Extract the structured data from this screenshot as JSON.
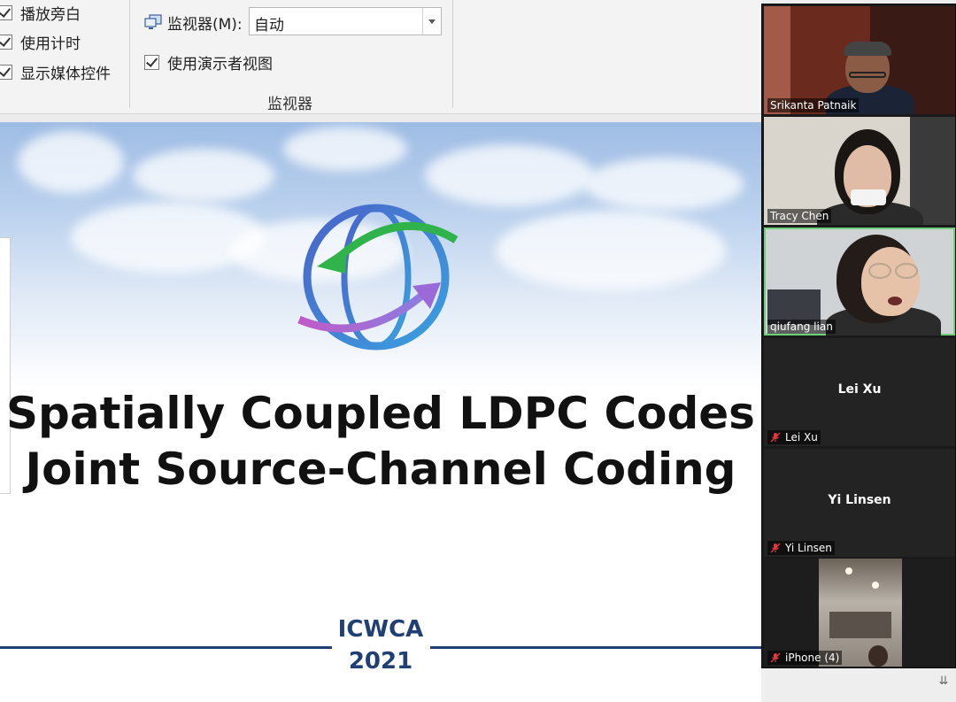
{
  "ribbon": {
    "checkboxes": [
      {
        "label": "播放旁白",
        "checked": true
      },
      {
        "label": "使用计时",
        "checked": true
      },
      {
        "label": "显示媒体控件",
        "checked": true
      }
    ],
    "monitor": {
      "label": "监视器(M):",
      "value": "自动",
      "presenter_view_label": "使用演示者视图",
      "presenter_view_checked": true,
      "group_label": "监视器"
    },
    "icons": [
      "monitor-icon",
      "chevron-down-icon"
    ]
  },
  "slide": {
    "title_line1": "Spatially Coupled LDPC Codes",
    "title_line2": "Joint Source-Channel Coding",
    "footer_org": "ICWCA",
    "footer_year": "2021",
    "logo": "globe-arrows-logo",
    "colors": {
      "title": "#111111",
      "footer": "#1f3f75",
      "logo_blue": "#3b6fd0",
      "logo_green": "#2fb34a",
      "logo_purple": "#b36ad0"
    }
  },
  "participants": [
    {
      "name": "Srikanta Patnaik",
      "video": true,
      "muted": false,
      "active": false
    },
    {
      "name": "Tracy Chen",
      "video": true,
      "muted": false,
      "active": false
    },
    {
      "name": "qiufang lian",
      "video": true,
      "muted": false,
      "active": true
    },
    {
      "name": "Lei Xu",
      "video": false,
      "muted": true,
      "active": false
    },
    {
      "name": "Yi Linsen",
      "video": false,
      "muted": true,
      "active": false
    },
    {
      "name": "iPhone (4)",
      "video": true,
      "muted": true,
      "active": false
    }
  ],
  "colors": {
    "active_speaker_border": "#6fd07a",
    "muted_mic": "#e0383e"
  }
}
